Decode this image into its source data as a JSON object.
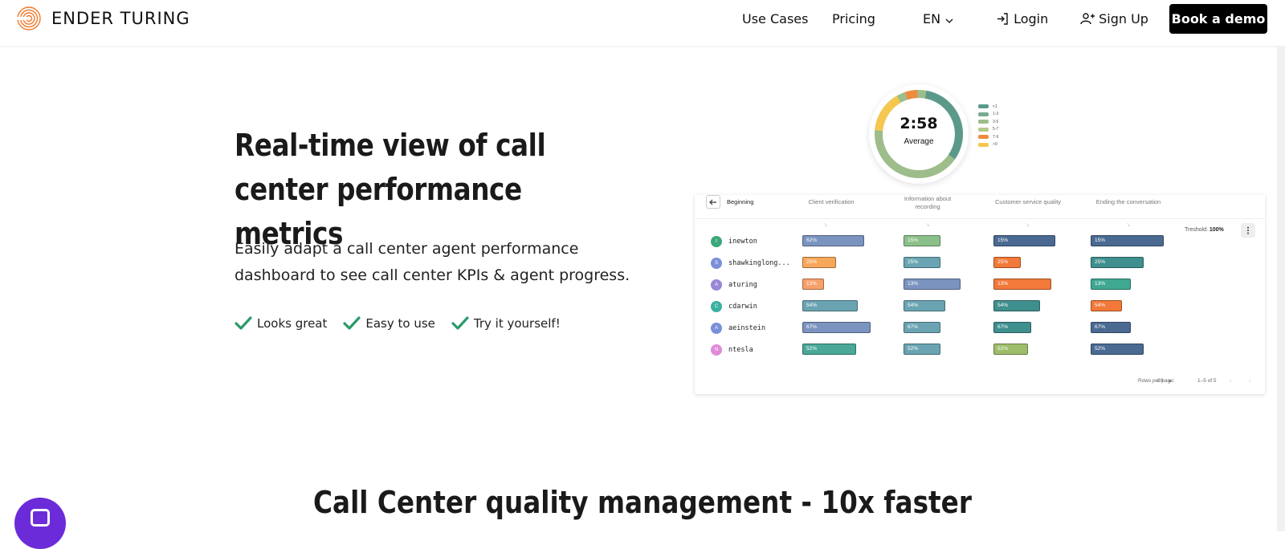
{
  "nav": {
    "brand": "ENDER TURING",
    "use_cases": "Use Cases",
    "pricing": "Pricing",
    "language": "EN",
    "login": "Login",
    "signup": "Sign Up",
    "book_demo": "Book a demo"
  },
  "hero": {
    "title": "Real-time view of call center performance metrics",
    "subtitle": "Easily adapt a call center agent performance dashboard to see call center KPIs & agent progress.",
    "features": [
      "Looks great",
      "Easy to use",
      "Try it yourself!"
    ]
  },
  "donut": {
    "time": "2:58",
    "label": "Average",
    "legend": [
      {
        "label": "<1",
        "color": "#5b9a8b"
      },
      {
        "label": "1-3",
        "color": "#7aa98f"
      },
      {
        "label": "3-5",
        "color": "#9dbd8a"
      },
      {
        "label": "5-7",
        "color": "#b5c98a"
      },
      {
        "label": "7-9",
        "color": "#f08a3c"
      },
      {
        "label": ">9",
        "color": "#f6c74f"
      }
    ]
  },
  "dashboard": {
    "columns": [
      "Beginning",
      "Client verification",
      "Information about recording",
      "Customer service quality",
      "Ending the conversation"
    ],
    "threshold_label": "Treshold:",
    "threshold_value": "100%",
    "rows_per_page_label": "Rows per page:",
    "rows_per_page": "20",
    "pagination": "1–5 of 5",
    "agents": [
      {
        "initial": "I",
        "name": "inewton",
        "avatar_color": "#3aa87a",
        "bars": [
          {
            "v": "62%",
            "c": "#7b93bf",
            "w": 77
          },
          {
            "v": "15%",
            "c": "#8cc08a",
            "w": 46
          },
          {
            "v": "15%",
            "c": "#4a6a92",
            "w": 77
          },
          {
            "v": "15%",
            "c": "#4a6a92",
            "w": 91
          }
        ]
      },
      {
        "initial": "S",
        "name": "shawkinglong...",
        "avatar_color": "#7b8fd9",
        "bars": [
          {
            "v": "25%",
            "c": "#f6a75a",
            "w": 42
          },
          {
            "v": "25%",
            "c": "#6aa4b2",
            "w": 46
          },
          {
            "v": "25%",
            "c": "#f2793a",
            "w": 34
          },
          {
            "v": "25%",
            "c": "#3f8f8e",
            "w": 66
          }
        ]
      },
      {
        "initial": "A",
        "name": "aturing",
        "avatar_color": "#9a86d6",
        "bars": [
          {
            "v": "13%",
            "c": "#f6a06a",
            "w": 27
          },
          {
            "v": "13%",
            "c": "#7b93bf",
            "w": 71
          },
          {
            "v": "13%",
            "c": "#f2793a",
            "w": 72
          },
          {
            "v": "13%",
            "c": "#3fa891",
            "w": 50
          }
        ]
      },
      {
        "initial": "C",
        "name": "cdarwin",
        "avatar_color": "#3ab0a0",
        "bars": [
          {
            "v": "54%",
            "c": "#6aa4b2",
            "w": 69
          },
          {
            "v": "54%",
            "c": "#6aa4b2",
            "w": 52
          },
          {
            "v": "54%",
            "c": "#3f8f8e",
            "w": 58
          },
          {
            "v": "54%",
            "c": "#f2793a",
            "w": 39
          }
        ]
      },
      {
        "initial": "A",
        "name": "aeinstein",
        "avatar_color": "#7b8fd9",
        "bars": [
          {
            "v": "67%",
            "c": "#7b93bf",
            "w": 85
          },
          {
            "v": "67%",
            "c": "#6aa4b2",
            "w": 46
          },
          {
            "v": "67%",
            "c": "#3f8f8e",
            "w": 47
          },
          {
            "v": "67%",
            "c": "#4a6a92",
            "w": 50
          }
        ]
      },
      {
        "initial": "N",
        "name": "ntesla",
        "avatar_color": "#e08ad9",
        "bars": [
          {
            "v": "52%",
            "c": "#4aa898",
            "w": 67
          },
          {
            "v": "52%",
            "c": "#6aa4b2",
            "w": 46
          },
          {
            "v": "52%",
            "c": "#9dbd6a",
            "w": 43
          },
          {
            "v": "52%",
            "c": "#4a6a92",
            "w": 66
          }
        ]
      }
    ]
  },
  "section2": {
    "title": "Call Center quality management - 10x faster"
  },
  "colors": {
    "accent_check": "#2a9a6a",
    "chat": "#6c2bd9"
  }
}
